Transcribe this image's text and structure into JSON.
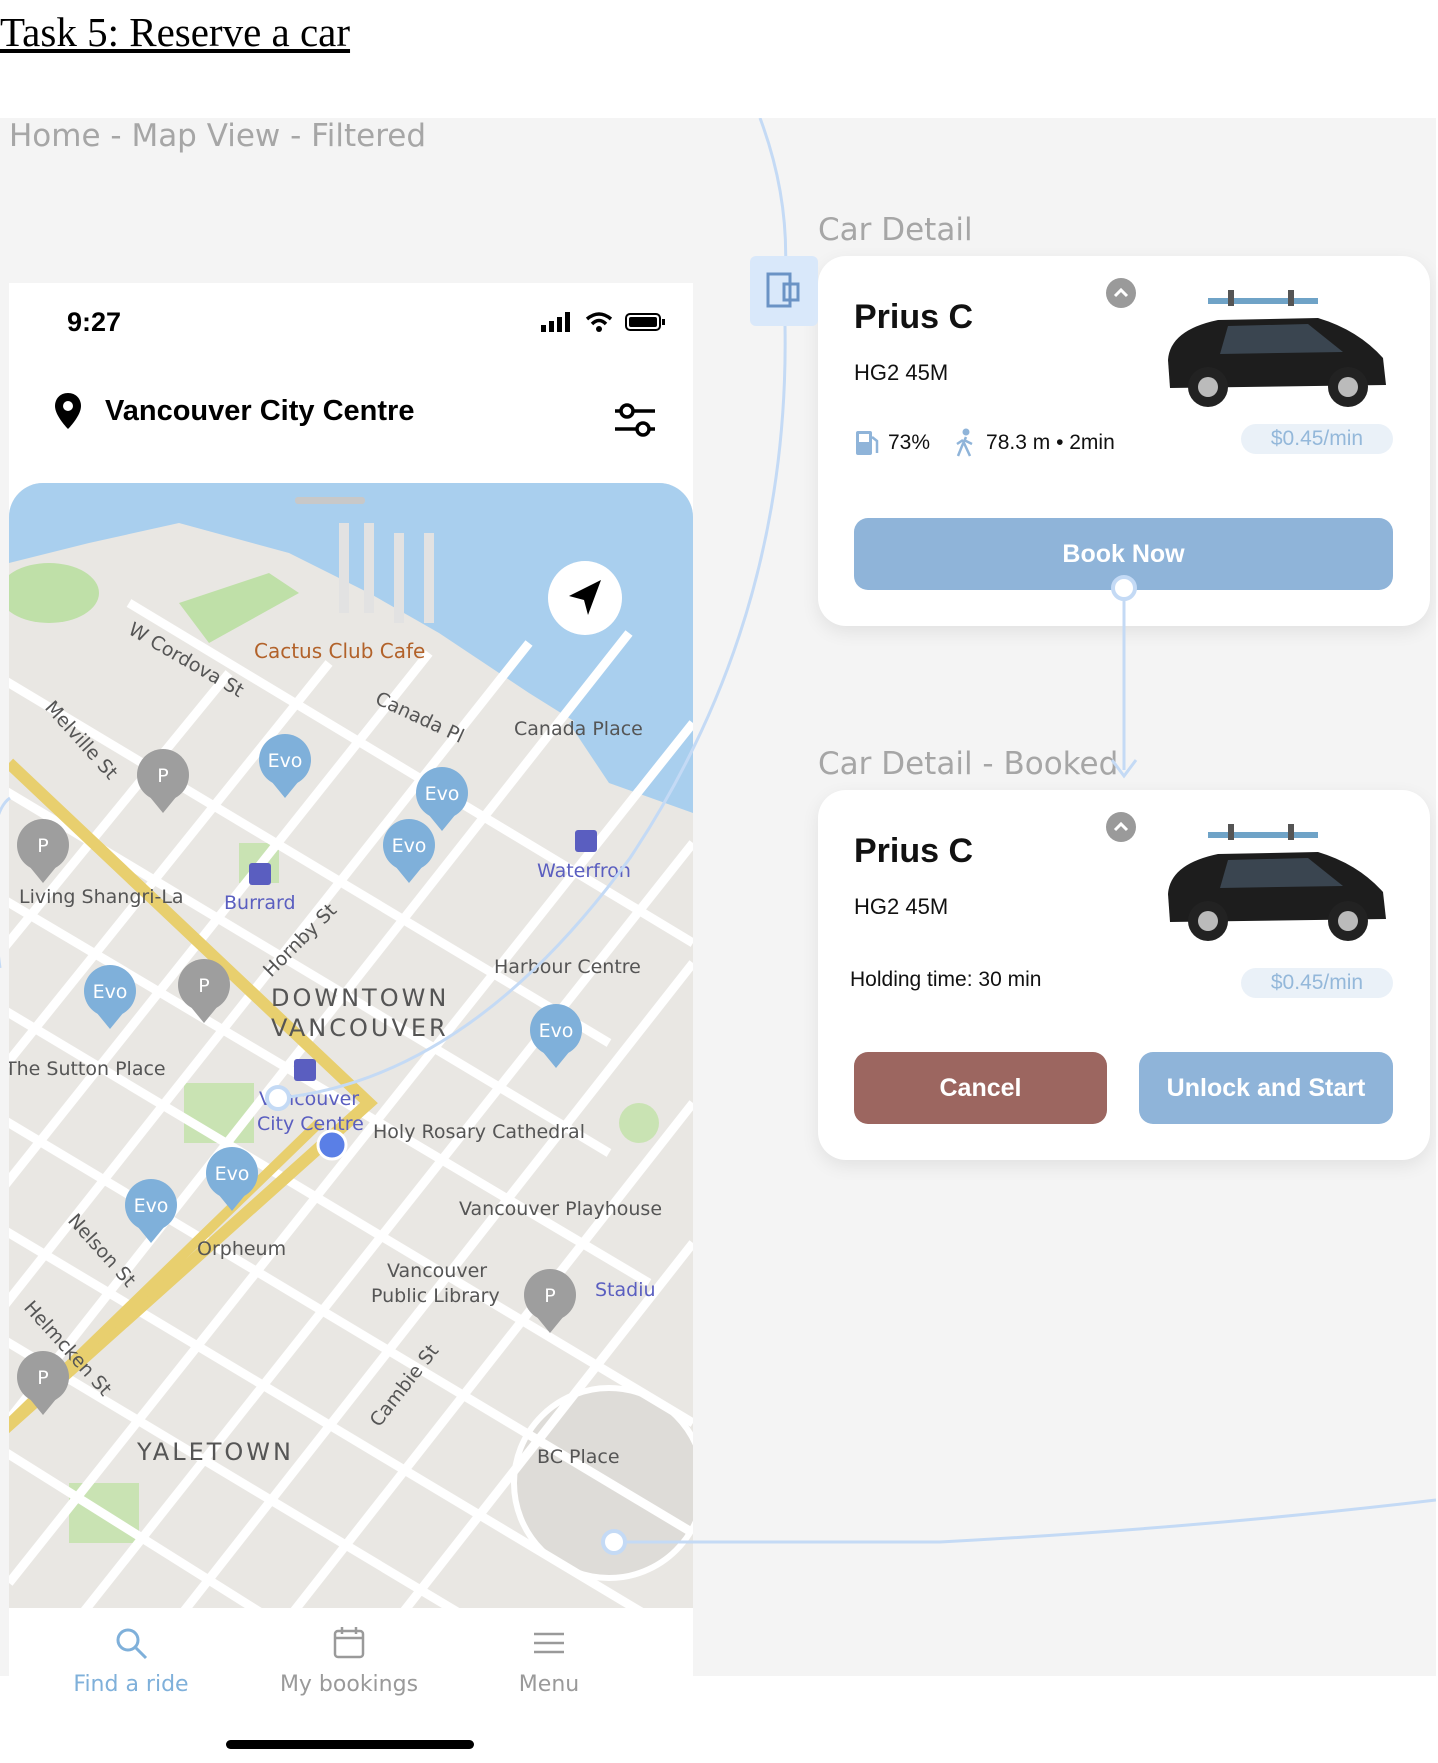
{
  "task_title": "Task 5: Reserve a car",
  "frames": {
    "home": "Home - Map View - Filtered",
    "car_detail": "Car Detail",
    "car_detail_booked": "Car Detail - Booked"
  },
  "phone": {
    "time": "9:27",
    "location": "Vancouver City Centre"
  },
  "map": {
    "labels": {
      "cactus": "Cactus Club Cafe",
      "cordova": "W Cordova St",
      "canada_pl": "Canada Pl",
      "canada_place": "Canada Place",
      "melville": "Melville St",
      "waterfront": "Waterfron",
      "shangri": "Living Shangri-La",
      "burrard": "Burrard",
      "hornby": "Hornby St",
      "harbour": "Harbour Centre",
      "downtown1": "DOWNTOWN",
      "downtown2": "VANCOUVER",
      "sutton": "The Sutton Place",
      "vcc1": "Vancouver",
      "vcc2": "City Centre",
      "holy": "Holy Rosary Cathedral",
      "playhouse": "Vancouver Playhouse",
      "orpheum": "Orpheum",
      "nelson": "Nelson St",
      "library1": "Vancouver",
      "library2": "Public Library",
      "stadium": "Stadiu",
      "helmcken": "Helmcken St",
      "cambie": "Cambie St",
      "yaletown": "YALETOWN",
      "bcplace": "BC Place"
    },
    "evo_label": "Evo",
    "parking_label": "P"
  },
  "tabs": {
    "find": "Find a ride",
    "bookings": "My bookings",
    "menu": "Menu"
  },
  "card1": {
    "name": "Prius C",
    "plate": "HG2 45M",
    "fuel": "73%",
    "distance": "78.3 m • 2min",
    "price": "$0.45/min",
    "book": "Book Now"
  },
  "card2": {
    "name": "Prius C",
    "plate": "HG2 45M",
    "holding": "Holding time: 30 min",
    "price": "$0.45/min",
    "cancel": "Cancel",
    "unlock": "Unlock and Start"
  },
  "colors": {
    "primary": "#8fb4d9",
    "cancel": "#9c6660",
    "evo_pin": "#7fb0da",
    "parking_pin": "#9e9e9e",
    "water": "#a9cfee",
    "flow_line": "#c4daf5"
  }
}
